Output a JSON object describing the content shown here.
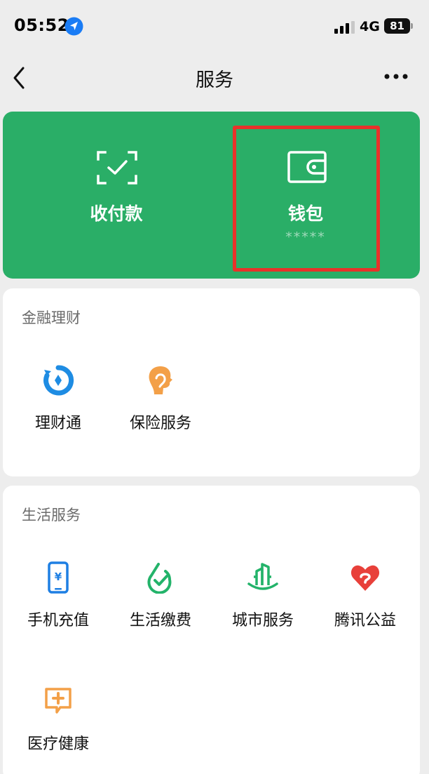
{
  "status_bar": {
    "time": "05:52",
    "network": "4G",
    "battery": "81"
  },
  "nav": {
    "title": "服务"
  },
  "pay_card": {
    "pay_label": "收付款",
    "wallet_label": "钱包",
    "wallet_balance_masked": "*****",
    "background_color": "#2aae67",
    "highlight_color": "#e8322a"
  },
  "finance": {
    "title": "金融理财",
    "items": [
      {
        "label": "理财通",
        "icon": "licaitong-icon"
      },
      {
        "label": "保险服务",
        "icon": "insurance-icon"
      }
    ]
  },
  "life": {
    "title": "生活服务",
    "items": [
      {
        "label": "手机充值",
        "icon": "phone-recharge-icon"
      },
      {
        "label": "生活缴费",
        "icon": "utility-payment-icon"
      },
      {
        "label": "城市服务",
        "icon": "city-service-icon"
      },
      {
        "label": "腾讯公益",
        "icon": "charity-heart-icon"
      },
      {
        "label": "医疗健康",
        "icon": "medical-health-icon"
      }
    ]
  }
}
